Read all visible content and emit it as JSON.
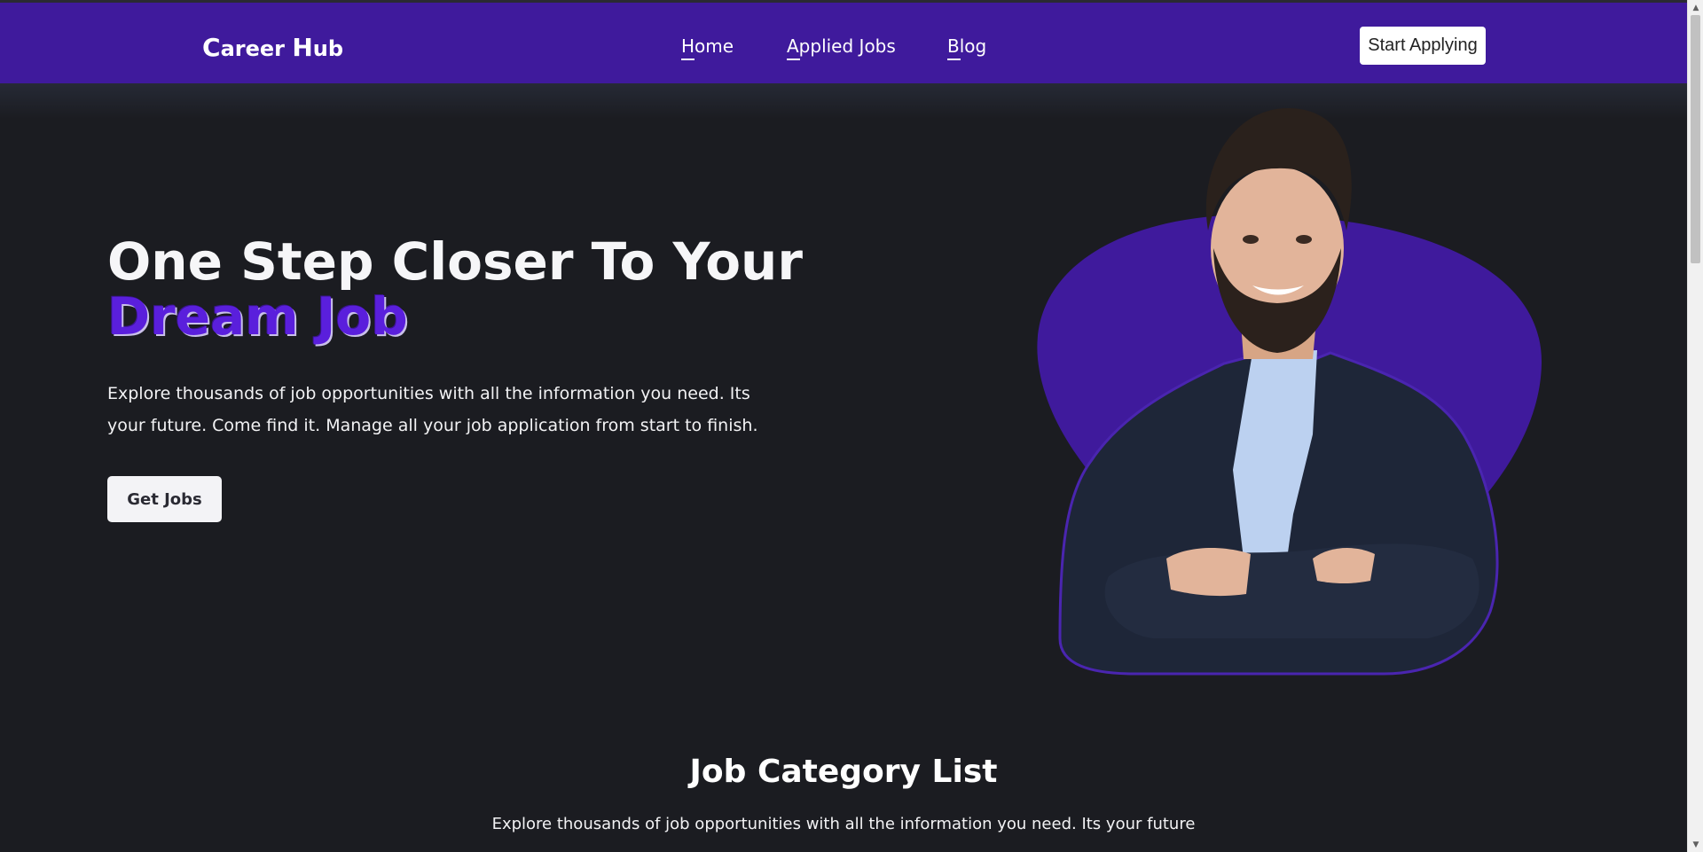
{
  "navbar": {
    "brand_first_initial": "C",
    "brand_first_rest": "areer",
    "brand_second_initial": "H",
    "brand_second_rest": "ub",
    "links": [
      {
        "label": "Home"
      },
      {
        "label": "Applied Jobs"
      },
      {
        "label": "Blog"
      }
    ],
    "cta_label": "Start Applying"
  },
  "hero": {
    "title_plain": "One Step Closer To Your ",
    "title_accent": "Dream Job",
    "description": "Explore thousands of job opportunities with all the information you need. Its your future. Come find it. Manage all your job application from start to finish.",
    "button_label": "Get Jobs"
  },
  "categories": {
    "title": "Job Category List",
    "description": "Explore thousands of job opportunities with all the information you need. Its your future"
  },
  "colors": {
    "navbar_bg": "#3f1a9c",
    "accent": "#5a1fdc",
    "page_bg": "#1b1c21",
    "blob": "#3f1a9c"
  }
}
